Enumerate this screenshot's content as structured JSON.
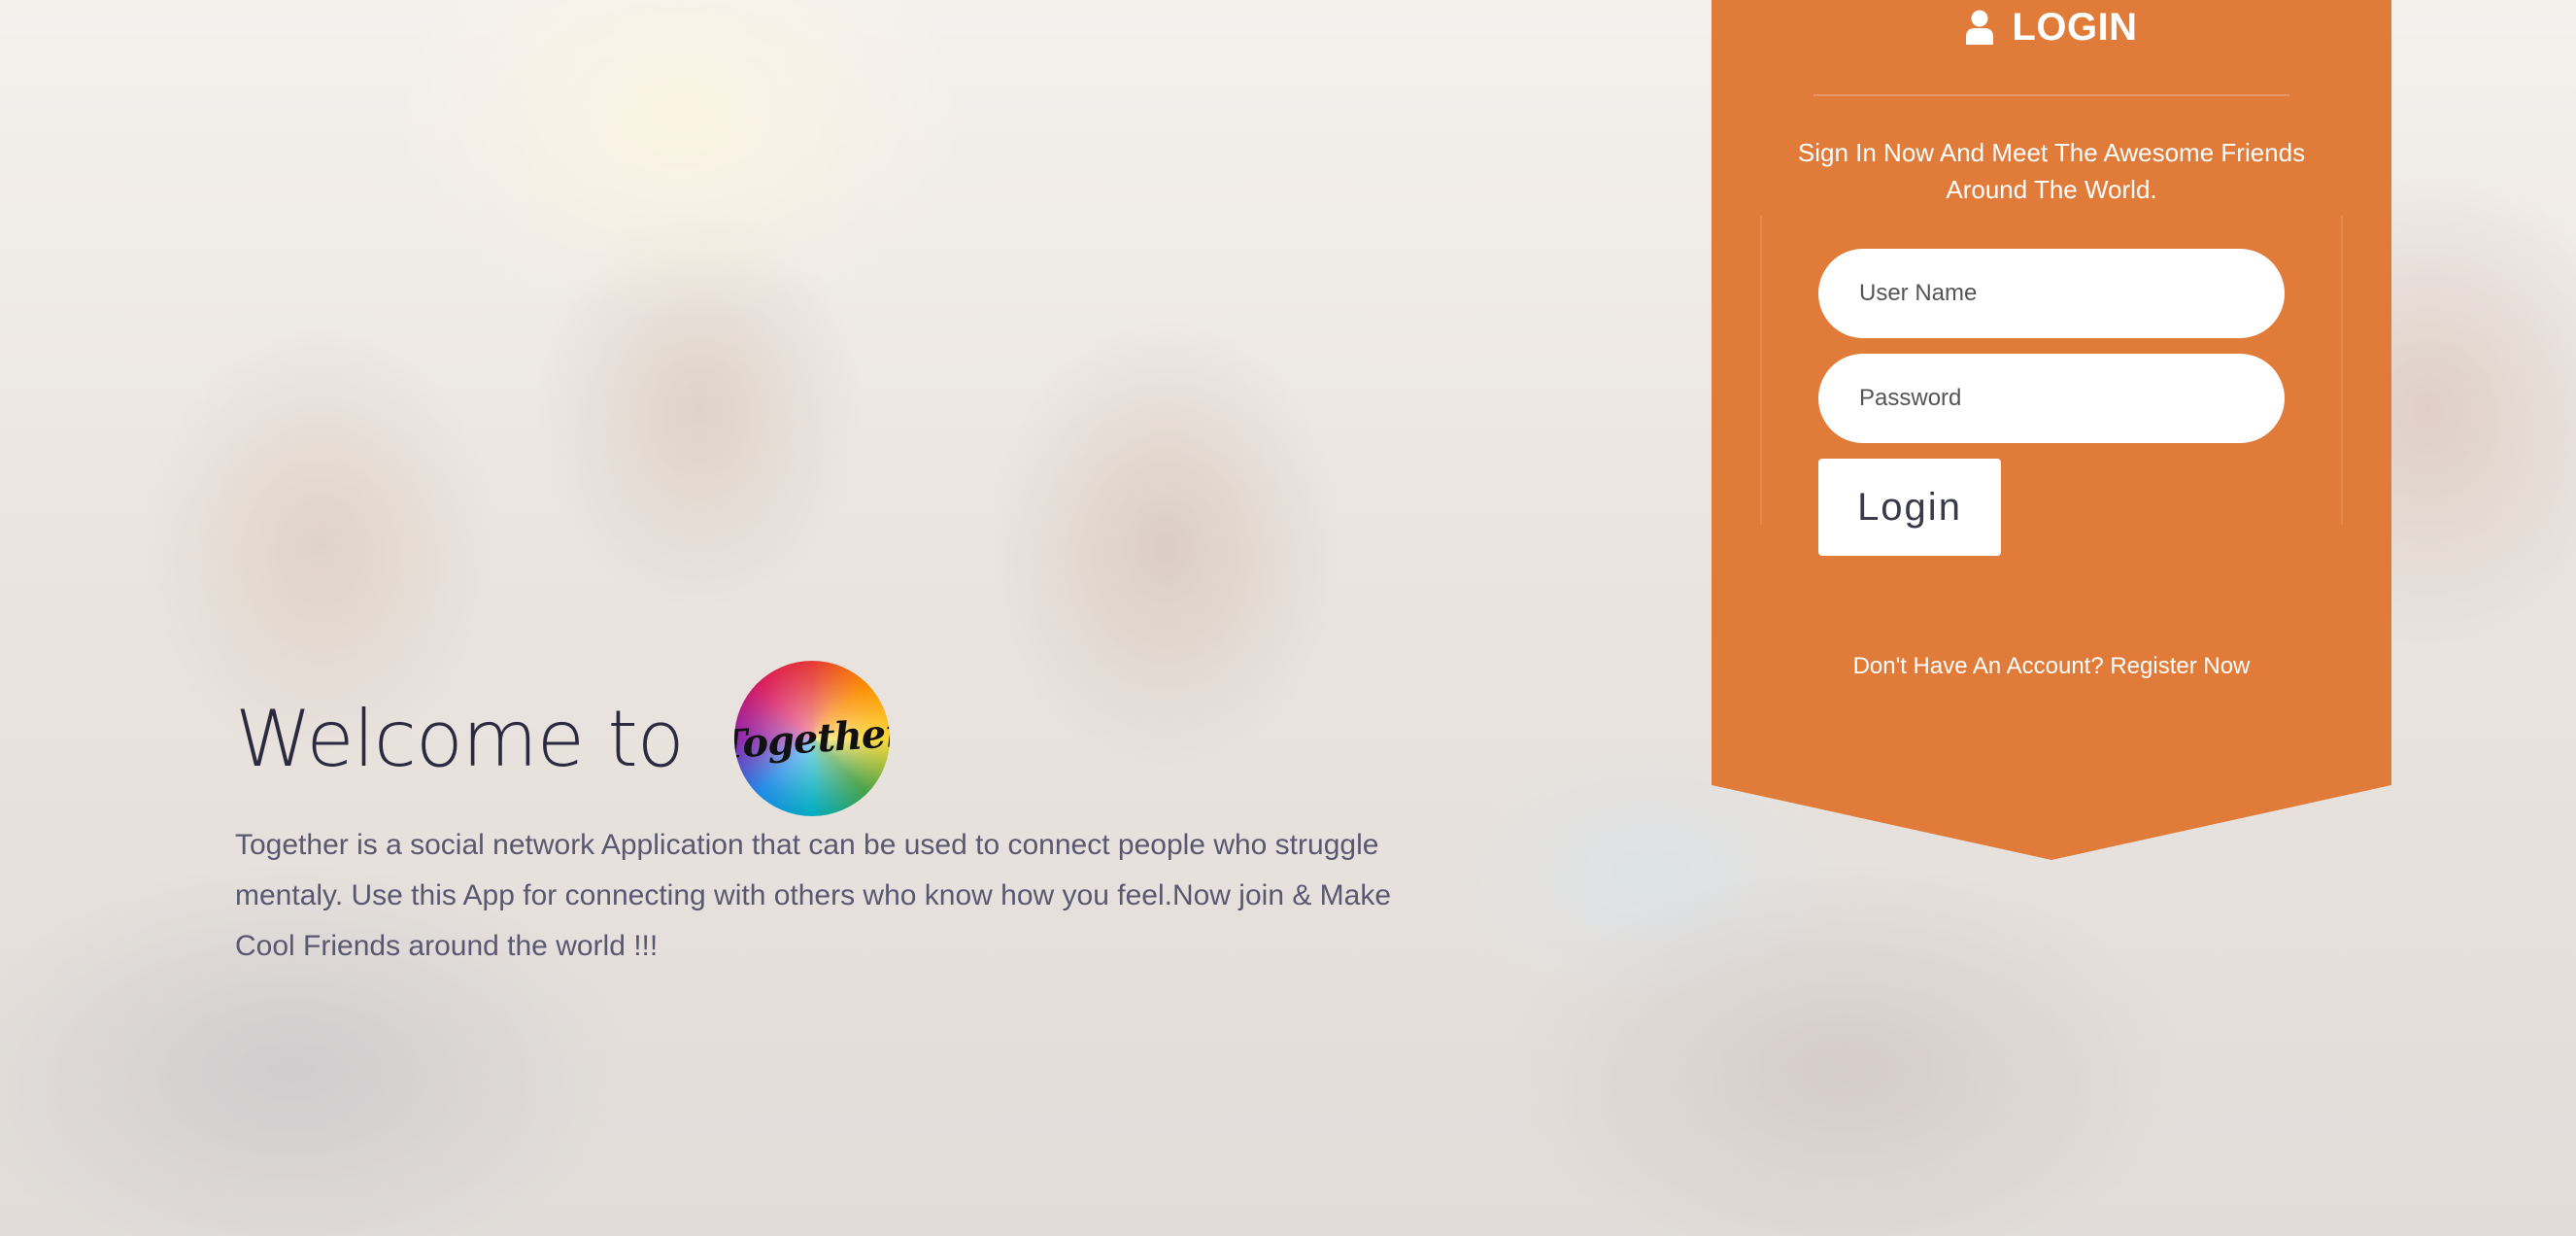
{
  "hero": {
    "welcome_text": "Welcome to",
    "logo_text": "Together",
    "description": "Together is a social network Application that can be used to connect people who struggle mentaly. Use this App for connecting with others who know how you feel.Now join & Make Cool Friends around the world !!!"
  },
  "login": {
    "title": "LOGIN",
    "icon": "user-icon",
    "subtitle": "Sign In Now And Meet The Awesome Friends Around The World.",
    "username_placeholder": "User Name",
    "password_placeholder": "Password",
    "button_label": "Login",
    "register_text": "Don't Have An Account? Register Now"
  },
  "colors": {
    "panel": "#e07b39",
    "title_text": "#2c2a40",
    "body_text": "#5a5870",
    "white": "#ffffff"
  }
}
